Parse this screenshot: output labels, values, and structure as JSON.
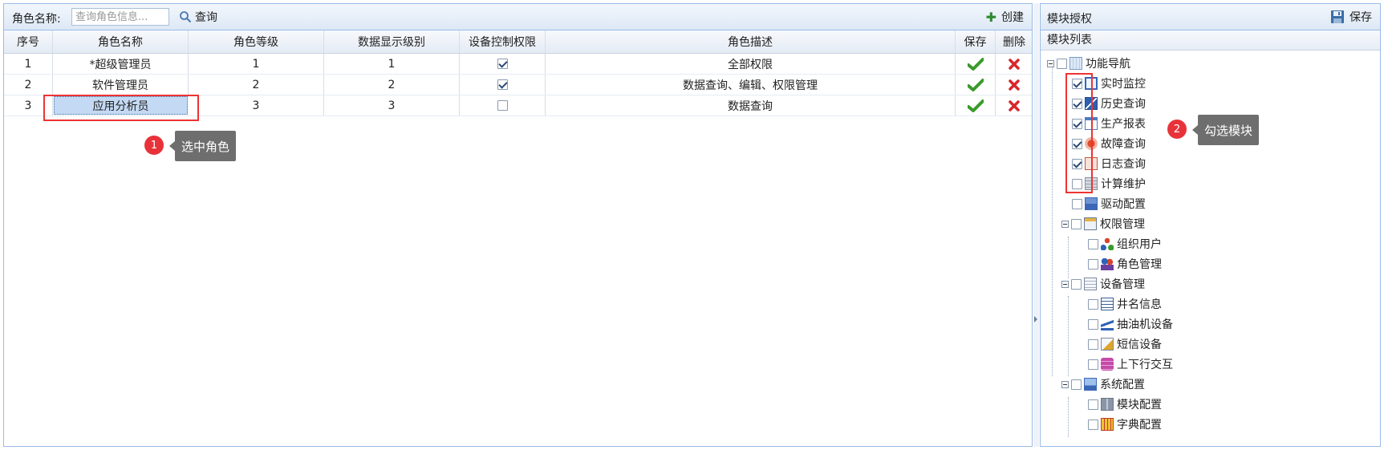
{
  "left": {
    "toolbar": {
      "label": "角色名称:",
      "search_placeholder": "查询角色信息...",
      "search_label": "查询",
      "create_label": "创建"
    },
    "columns": [
      "序号",
      "角色名称",
      "角色等级",
      "数据显示级别",
      "设备控制权限",
      "角色描述",
      "保存",
      "删除"
    ],
    "rows": [
      {
        "index": "1",
        "name": "*超级管理员",
        "level": "1",
        "data_level": "1",
        "device_control": true,
        "desc": "全部权限"
      },
      {
        "index": "2",
        "name": "软件管理员",
        "level": "2",
        "data_level": "2",
        "device_control": true,
        "desc": "数据查询、编辑、权限管理"
      },
      {
        "index": "3",
        "name": "应用分析员",
        "level": "3",
        "data_level": "3",
        "device_control": false,
        "desc": "数据查询"
      }
    ]
  },
  "callouts": [
    {
      "num": "1",
      "text": "选中角色"
    },
    {
      "num": "2",
      "text": "勾选模块"
    }
  ],
  "right": {
    "title": "模块授权",
    "save_label": "保存",
    "list_header": "模块列表",
    "tree": {
      "root": "功能导航",
      "items": [
        {
          "label": "实时监控",
          "checked": true
        },
        {
          "label": "历史查询",
          "checked": true
        },
        {
          "label": "生产报表",
          "checked": true
        },
        {
          "label": "故障查询",
          "checked": true
        },
        {
          "label": "日志查询",
          "checked": true
        },
        {
          "label": "计算维护",
          "checked": false
        },
        {
          "label": "驱动配置",
          "checked": false
        }
      ],
      "groups": [
        {
          "label": "权限管理",
          "children": [
            "组织用户",
            "角色管理"
          ]
        },
        {
          "label": "设备管理",
          "children": [
            "井名信息",
            "抽油机设备",
            "短信设备",
            "上下行交互"
          ]
        },
        {
          "label": "系统配置",
          "children": [
            "模块配置",
            "字典配置"
          ]
        }
      ]
    }
  },
  "colors": {
    "accent_red": "#e8323a",
    "check_green": "#3a9b2a",
    "delete_red": "#d8262b",
    "border_blue": "#99bbe8"
  }
}
